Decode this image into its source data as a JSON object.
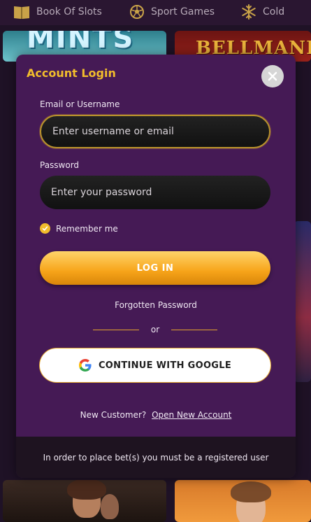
{
  "nav": {
    "items": [
      {
        "label": "Book Of Slots",
        "icon": "book-icon"
      },
      {
        "label": "Sport Games",
        "icon": "soccer-ball-icon"
      },
      {
        "label": "Cold",
        "icon": "snowflake-icon"
      }
    ]
  },
  "background_tiles": {
    "mints": "MINTS",
    "bellmania": "BELLMANIA"
  },
  "modal": {
    "title": "Account Login",
    "email_label": "Email or Username",
    "email_placeholder": "Enter username or email",
    "password_label": "Password",
    "password_placeholder": "Enter your password",
    "remember_label": "Remember me",
    "remember_checked": true,
    "login_button": "LOG IN",
    "forgot_link": "Forgotten Password",
    "or_text": "or",
    "google_button": "CONTINUE WITH GOOGLE",
    "new_customer_text": "New Customer?",
    "new_account_link": "Open New Account",
    "notice": "In order to place bet(s) you must be a registered user"
  },
  "colors": {
    "accent_gold": "#f2bd2c",
    "modal_bg": "#451a55",
    "page_bg": "#1f1226"
  }
}
